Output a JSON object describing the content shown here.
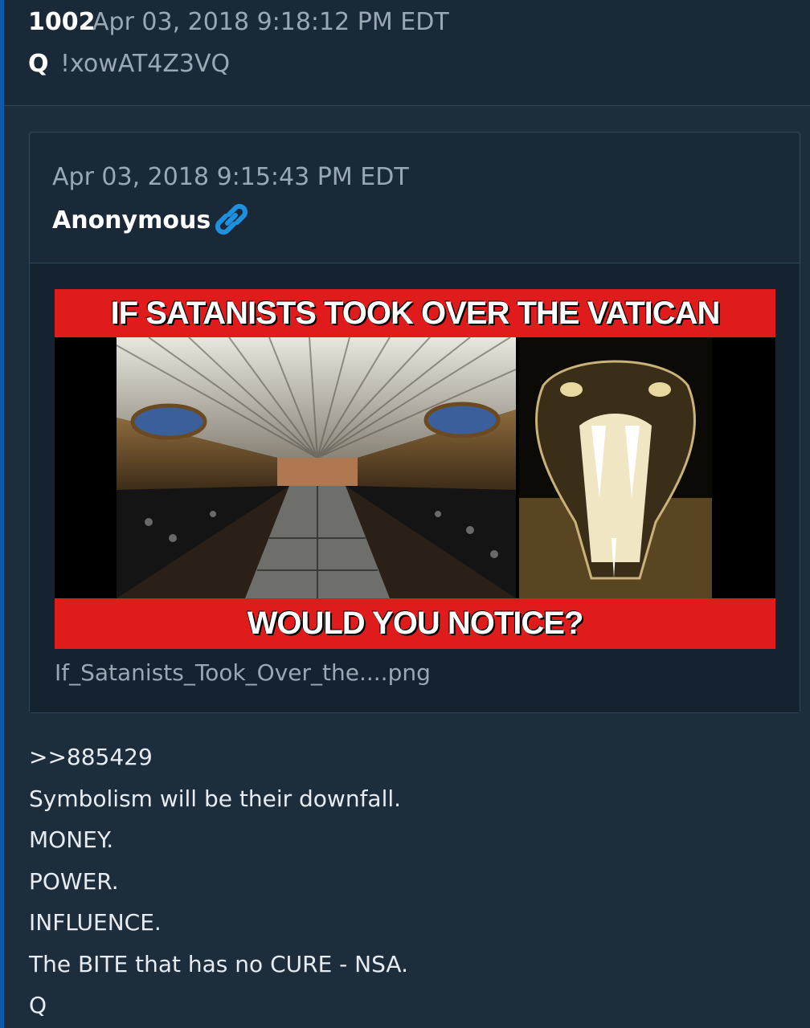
{
  "post": {
    "number": "1002",
    "date": "Apr 03, 2018 9:18:12 PM EDT",
    "author": "Q",
    "tripcode": "!xowAT4Z3VQ"
  },
  "quoted": {
    "date": "Apr 03, 2018 9:15:43 PM EDT",
    "author": "Anonymous",
    "link_icon": "link-icon",
    "image": {
      "top_text": "IF SATANISTS TOOK OVER THE VATICAN",
      "bottom_text": "WOULD YOU NOTICE?",
      "filename": "If_Satanists_Took_Over_the....png"
    }
  },
  "message": {
    "lines": [
      ">>885429",
      "Symbolism will be their downfall.",
      "MONEY.",
      "POWER.",
      "INFLUENCE.",
      "The BITE that has no CURE - NSA.",
      "Q"
    ]
  },
  "colors": {
    "background": "#1d2d3c",
    "header": "#1a2938",
    "accent_edge": "#0f5aa8",
    "link_icon": "#1e90e0",
    "meme_red": "#e01b1b"
  }
}
